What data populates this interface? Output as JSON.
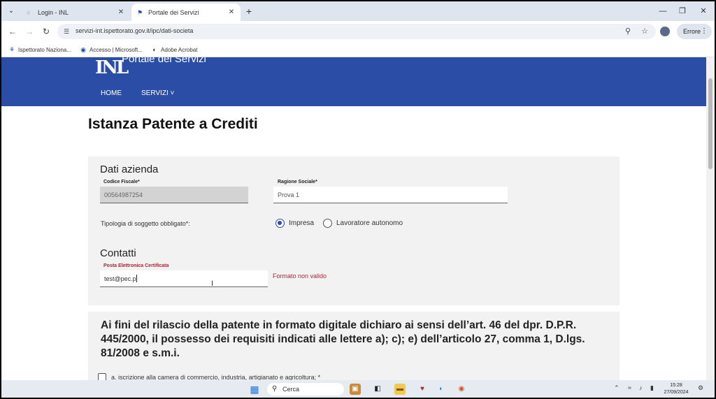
{
  "browser": {
    "tabs": [
      {
        "title": "Login - INL",
        "active": false
      },
      {
        "title": "Portale dei Servizi",
        "active": true
      }
    ],
    "url": "servizi-int.ispettorato.gov.it/ipc/dati-societa",
    "profile_button": "Errore",
    "bookmarks": [
      {
        "label": "Ispettorato Naziona..."
      },
      {
        "label": "Accesso | Microsoft..."
      },
      {
        "label": "Adobe Acrobat"
      }
    ]
  },
  "site": {
    "logo": "INL",
    "portal_title": "Portale dei Servizi",
    "nav": {
      "home": "HOME",
      "servizi": "SERVIZI ˅"
    }
  },
  "page": {
    "title": "Istanza Patente a Crediti",
    "dati_azienda": {
      "section_title": "Dati azienda",
      "codice_fiscale": {
        "label": "Codice Fiscale*",
        "value": "00564987254"
      },
      "ragione_sociale": {
        "label": "Ragione Sociale*",
        "value": "Prova 1"
      },
      "tipologia_label": "Tipologia di soggetto obbligato*:",
      "options": [
        {
          "label": "Impresa",
          "checked": true
        },
        {
          "label": "Lavoratore autonomo",
          "checked": false
        }
      ]
    },
    "contatti": {
      "section_title": "Contatti",
      "pec": {
        "label": "Posta Elettronica Certificata",
        "value": "test@pec.p"
      },
      "error": "Formato non valido"
    },
    "declaration": {
      "text": "Ai fini del rilascio della patente in formato digitale dichiaro ai sensi dell’art. 46 del dpr. D.P.R. 445/2000, il possesso dei requisiti indicati alle lettere a); c); e) dell’articolo 27, comma 1, D.lgs. 81/2008 e s.m.i.",
      "item_a": "a. iscrizione alla camera di commercio, industria, artigianato e agricoltura; *"
    }
  },
  "taskbar": {
    "search_placeholder": "Cerca",
    "time": "15:28",
    "date": "27/09/2024"
  }
}
